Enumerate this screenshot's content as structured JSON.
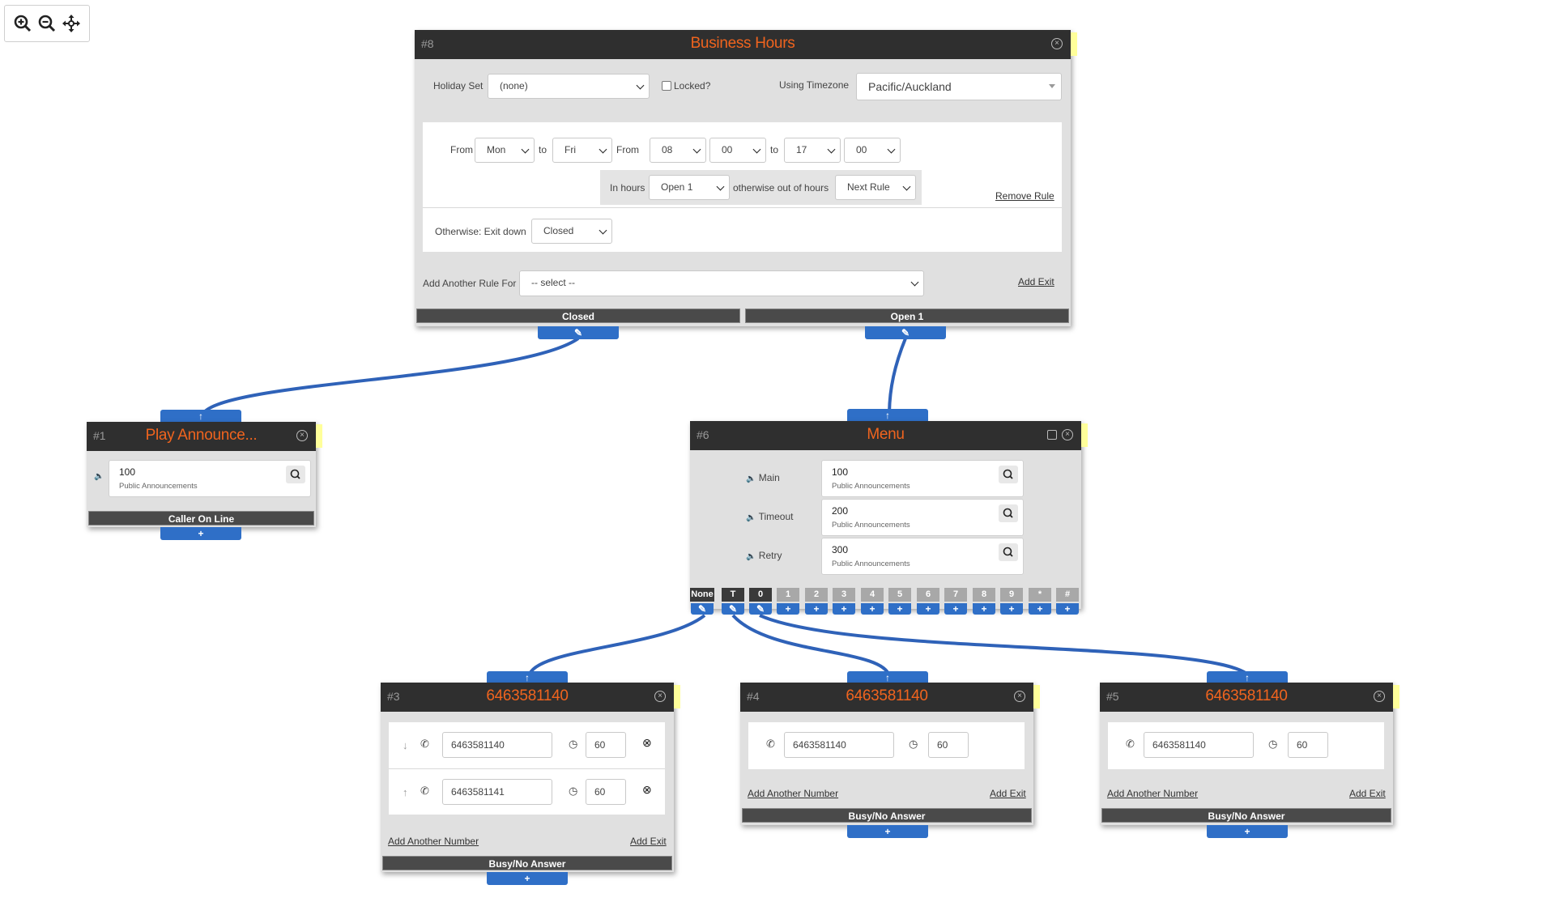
{
  "zoom_controls": {
    "zoom_in": "zoom-in-icon",
    "zoom_out": "zoom-out-icon",
    "pan": "move-icon"
  },
  "business_hours": {
    "num": "#8",
    "title": "Business Hours",
    "holiday_set_label": "Holiday Set",
    "holiday_set_value": "(none)",
    "locked_label": "Locked?",
    "timezone_label": "Using Timezone",
    "timezone_value": "Pacific/Auckland",
    "rule": {
      "from_label": "From",
      "day_from": "Mon",
      "to_label": "to",
      "day_to": "Fri",
      "from_label2": "From",
      "hour_from": "08",
      "min_from": "00",
      "to_label2": "to",
      "hour_to": "17",
      "min_to": "00",
      "in_hours_label": "In hours",
      "in_hours_value": "Open 1",
      "otherwise_label": "otherwise out of hours",
      "otherwise_value": "Next Rule",
      "remove_rule": "Remove Rule"
    },
    "otherwise_exit_label": "Otherwise: Exit down",
    "otherwise_exit_value": "Closed",
    "add_rule_label": "Add Another Rule For",
    "add_rule_value": "-- select --",
    "add_exit": "Add Exit",
    "exits": [
      "Closed",
      "Open 1"
    ]
  },
  "play_announcement": {
    "num": "#1",
    "title": "Play Announce...",
    "announcement": {
      "value": "100",
      "sub": "Public Announcements"
    },
    "exit": "Caller On Line"
  },
  "menu": {
    "num": "#6",
    "title": "Menu",
    "rows": [
      {
        "label": "Main",
        "value": "100",
        "sub": "Public Announcements"
      },
      {
        "label": "Timeout",
        "value": "200",
        "sub": "Public Announcements"
      },
      {
        "label": "Retry",
        "value": "300",
        "sub": "Public Announcements"
      }
    ],
    "keys": [
      "None",
      "T",
      "0",
      "1",
      "2",
      "3",
      "4",
      "5",
      "6",
      "7",
      "8",
      "9",
      "*",
      "#"
    ]
  },
  "dial3": {
    "num": "#3",
    "title": "6463581140",
    "numbers": [
      {
        "phone": "6463581140",
        "timeout": "60"
      },
      {
        "phone": "6463581141",
        "timeout": "60"
      }
    ],
    "add_number": "Add Another Number",
    "add_exit": "Add Exit",
    "exit": "Busy/No Answer"
  },
  "dial4": {
    "num": "#4",
    "title": "6463581140",
    "numbers": [
      {
        "phone": "6463581140",
        "timeout": "60"
      }
    ],
    "add_number": "Add Another Number",
    "add_exit": "Add Exit",
    "exit": "Busy/No Answer"
  },
  "dial5": {
    "num": "#5",
    "title": "6463581140",
    "numbers": [
      {
        "phone": "6463581140",
        "timeout": "60"
      }
    ],
    "add_number": "Add Another Number",
    "add_exit": "Add Exit",
    "exit": "Busy/No Answer"
  },
  "colors": {
    "accent": "#f0641e",
    "port": "#2f6fc7",
    "header": "#2f2f2f",
    "node_bg": "#e0e0e0",
    "connector": "#2f62b8"
  }
}
